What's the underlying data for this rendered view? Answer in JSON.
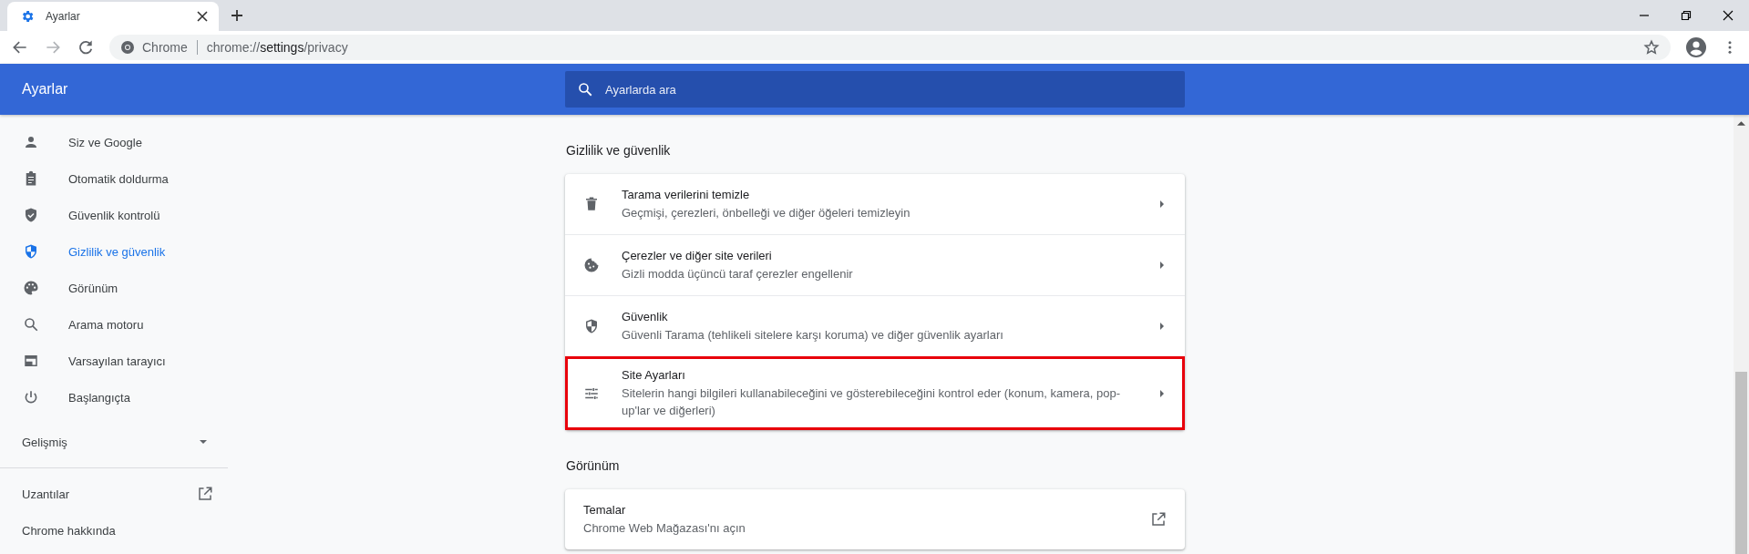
{
  "browser": {
    "tab": {
      "title": "Ayarlar"
    },
    "address": {
      "site_label": "Chrome",
      "url_prefix": "chrome://",
      "url_host": "settings",
      "url_path": "/privacy"
    }
  },
  "header": {
    "title": "Ayarlar",
    "search": {
      "placeholder": "Ayarlarda ara"
    }
  },
  "sidebar": {
    "items": [
      {
        "label": "Siz ve Google",
        "kind": "person",
        "selected": false
      },
      {
        "label": "Otomatik doldurma",
        "kind": "clipboard",
        "selected": false
      },
      {
        "label": "Güvenlik kontrolü",
        "kind": "shieldcheck",
        "selected": false
      },
      {
        "label": "Gizlilik ve güvenlik",
        "kind": "shieldhalf",
        "selected": true
      },
      {
        "label": "Görünüm",
        "kind": "palette",
        "selected": false
      },
      {
        "label": "Arama motoru",
        "kind": "search",
        "selected": false
      },
      {
        "label": "Varsayılan tarayıcı",
        "kind": "browser",
        "selected": false
      },
      {
        "label": "Başlangıçta",
        "kind": "power",
        "selected": false
      }
    ],
    "advanced": {
      "label": "Gelişmiş",
      "expanded": false
    },
    "links": [
      {
        "label": "Uzantılar",
        "external": true
      },
      {
        "label": "Chrome hakkında",
        "external": false
      }
    ]
  },
  "sections": [
    {
      "title": "Gizlilik ve güvenlik",
      "rows": [
        {
          "kind": "trash",
          "title": "Tarama verilerini temizle",
          "description": "Geçmişi, çerezleri, önbelleği ve diğer öğeleri temizleyin",
          "external": false,
          "highlighted": false
        },
        {
          "kind": "cookie",
          "title": "Çerezler ve diğer site verileri",
          "description": "Gizli modda üçüncü taraf çerezler engellenir",
          "external": false,
          "highlighted": false
        },
        {
          "kind": "shieldhalf",
          "title": "Güvenlik",
          "description": "Güvenli Tarama (tehlikeli sitelere karşı koruma) ve diğer güvenlik ayarları",
          "external": false,
          "highlighted": false
        },
        {
          "kind": "tune",
          "title": "Site Ayarları",
          "description": "Sitelerin hangi bilgileri kullanabileceğini ve gösterebileceğini kontrol eder (konum, kamera, pop-up'lar ve diğerleri)",
          "external": false,
          "highlighted": true
        }
      ]
    },
    {
      "title": "Görünüm",
      "rows": [
        {
          "kind": "plain",
          "title": "Temalar",
          "description": "Chrome Web Mağazası'nı açın",
          "external": true,
          "highlighted": false
        }
      ]
    }
  ]
}
